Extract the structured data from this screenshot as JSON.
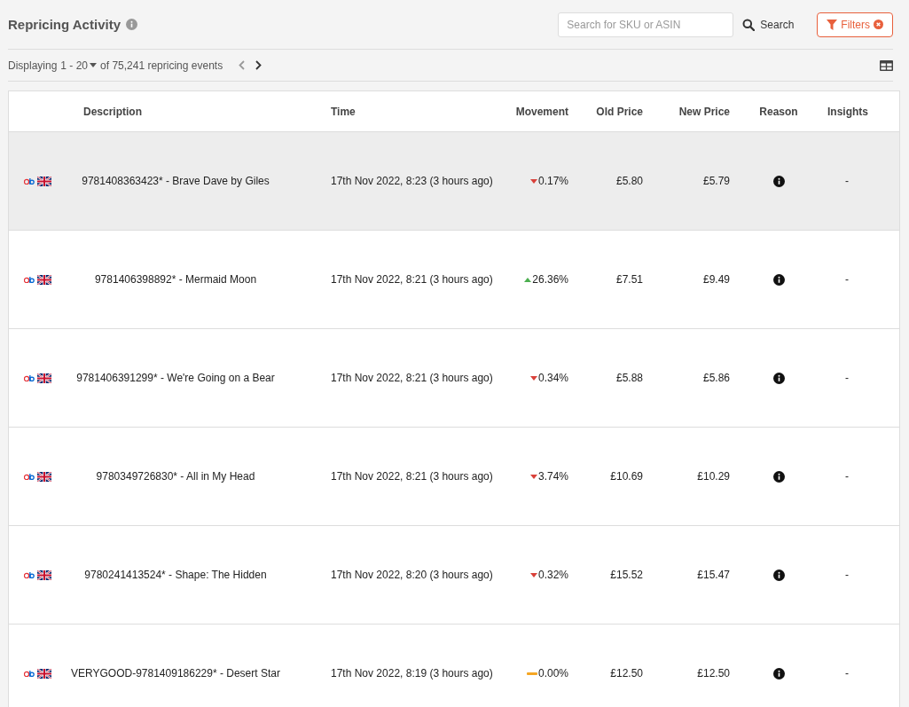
{
  "title": "Repricing Activity",
  "search": {
    "placeholder": "Search for SKU or ASIN",
    "button": "Search"
  },
  "filters_button": "Filters",
  "pagination": {
    "prefix": "Displaying",
    "range": "1 - 20",
    "suffix": "of 75,241 repricing events"
  },
  "table": {
    "columns": [
      "Description",
      "Time",
      "Movement",
      "Old Price",
      "New Price",
      "Reason",
      "Insights"
    ],
    "rows": [
      {
        "selected": true,
        "description": "9781408363423* - Brave Dave by Giles",
        "time": "17th Nov 2022, 8:23 (3 hours ago)",
        "kind": "down",
        "movement": "0.17%",
        "old_price": "£5.80",
        "new_price": "£5.79",
        "insights": "-"
      },
      {
        "selected": false,
        "description": "9781406398892* - Mermaid Moon",
        "time": "17th Nov 2022, 8:21 (3 hours ago)",
        "kind": "up",
        "movement": "26.36%",
        "old_price": "£7.51",
        "new_price": "£9.49",
        "insights": "-"
      },
      {
        "selected": false,
        "description": "9781406391299* - We're Going on a Bear",
        "time": "17th Nov 2022, 8:21 (3 hours ago)",
        "kind": "down",
        "movement": "0.34%",
        "old_price": "£5.88",
        "new_price": "£5.86",
        "insights": "-"
      },
      {
        "selected": false,
        "description": "9780349726830* - All in My Head",
        "time": "17th Nov 2022, 8:21 (3 hours ago)",
        "kind": "down",
        "movement": "3.74%",
        "old_price": "£10.69",
        "new_price": "£10.29",
        "insights": "-"
      },
      {
        "selected": false,
        "description": "9780241413524* - Shape: The Hidden",
        "time": "17th Nov 2022, 8:20 (3 hours ago)",
        "kind": "down",
        "movement": "0.32%",
        "old_price": "£15.52",
        "new_price": "£15.47",
        "insights": "-"
      },
      {
        "selected": false,
        "description": "VERYGOOD-9781409186229* - Desert Star",
        "time": "17th Nov 2022, 8:19 (3 hours ago)",
        "kind": "flat",
        "movement": "0.00%",
        "old_price": "£12.50",
        "new_price": "£12.50",
        "insights": "-"
      }
    ]
  }
}
